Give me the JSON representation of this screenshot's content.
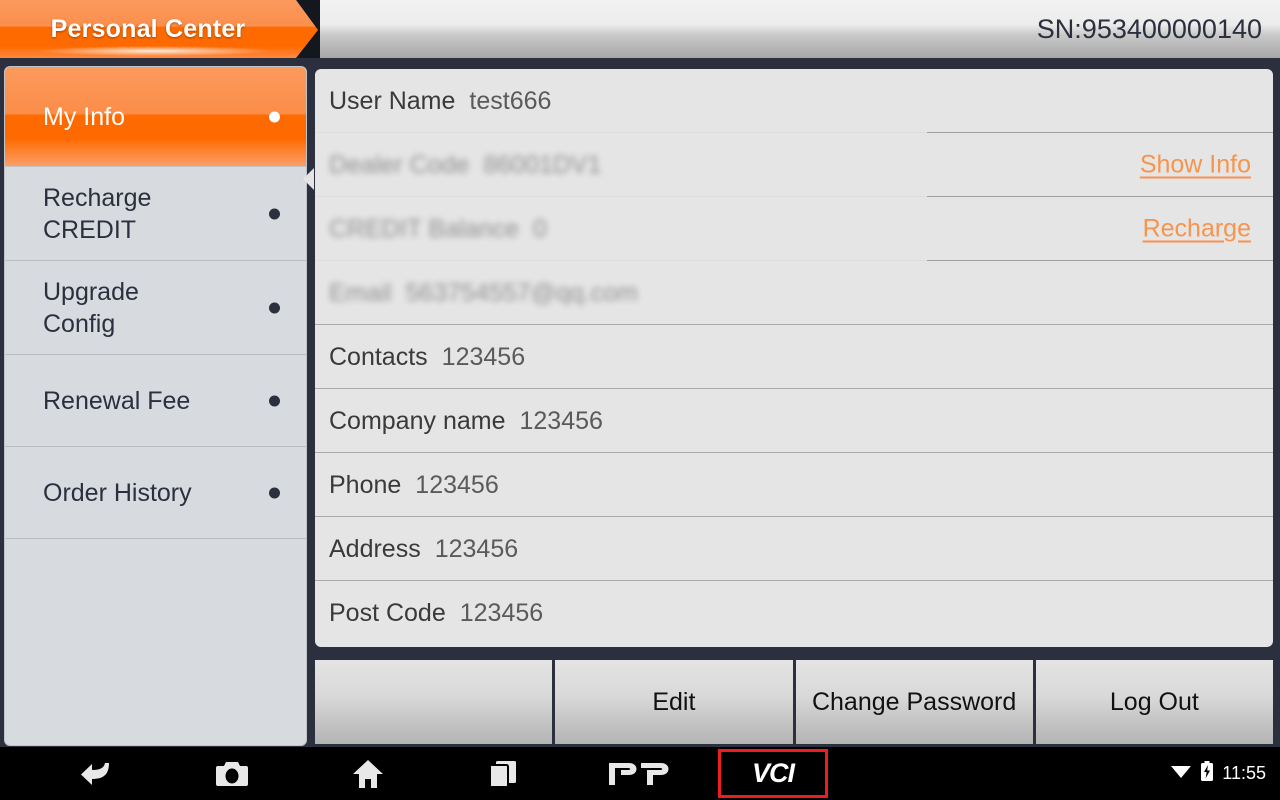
{
  "header": {
    "title": "Personal Center",
    "serial": "SN:953400000140"
  },
  "sidebar": {
    "items": [
      {
        "label": "My Info",
        "active": true,
        "dot": "bullet-dot-icon"
      },
      {
        "label": "Recharge\nCREDIT",
        "active": false,
        "dot": "bullet-dot-icon"
      },
      {
        "label": "Upgrade\nConfig",
        "active": false,
        "dot": "bullet-dot-icon"
      },
      {
        "label": "Renewal Fee",
        "active": false,
        "dot": "bullet-dot-icon"
      },
      {
        "label": "Order History",
        "active": false,
        "dot": "bullet-dot-icon"
      }
    ]
  },
  "main": {
    "rows": [
      {
        "label": "User Name",
        "value": "test666",
        "blurred": false,
        "action": ""
      },
      {
        "label": "Dealer Code",
        "value": "86001DV1",
        "blurred": true,
        "action": "Show Info"
      },
      {
        "label": "CREDIT Balance",
        "value": "0",
        "blurred": true,
        "action": "Recharge"
      },
      {
        "label": "Email",
        "value": "563754557@qq.com",
        "blurred": true,
        "action": ""
      },
      {
        "label": "Contacts",
        "value": "123456",
        "blurred": false,
        "action": ""
      },
      {
        "label": "Company name",
        "value": "123456",
        "blurred": false,
        "action": ""
      },
      {
        "label": "Phone",
        "value": "123456",
        "blurred": false,
        "action": ""
      },
      {
        "label": "Address",
        "value": "123456",
        "blurred": false,
        "action": ""
      },
      {
        "label": "Post Code",
        "value": "123456",
        "blurred": false,
        "action": ""
      }
    ]
  },
  "buttons": [
    {
      "label": ""
    },
    {
      "label": "Edit"
    },
    {
      "label": "Change Password"
    },
    {
      "label": "Log Out"
    }
  ],
  "navbar": {
    "back": "back-arrow-icon",
    "camera": "camera-icon",
    "home": "home-icon",
    "recent": "recent-apps-icon",
    "dp": "DP",
    "vci": "VCI",
    "wifi": "wifi-icon",
    "battery": "battery-charging-icon",
    "clock": "11:55"
  },
  "colors": {
    "accent_orange": "#fe6a00",
    "link_orange": "#f7944d",
    "panel_border": "#2b2f3e",
    "vci_highlight": "#ee1d23",
    "sidebar_bg": "#d7dade",
    "panel_bg": "#e5e5e5"
  }
}
